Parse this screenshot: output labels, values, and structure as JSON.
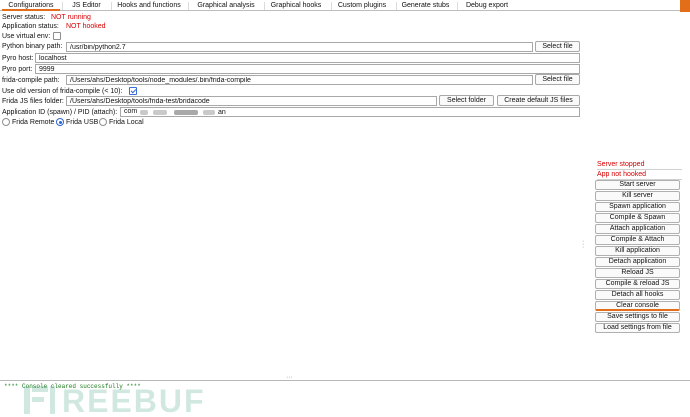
{
  "tabs": [
    {
      "label": "Configurations",
      "active": true
    },
    {
      "label": "JS Editor",
      "active": false
    },
    {
      "label": "Hooks and functions",
      "active": false
    },
    {
      "label": "Graphical analysis",
      "active": false
    },
    {
      "label": "Graphical hooks",
      "active": false
    },
    {
      "label": "Custom plugins",
      "active": false
    },
    {
      "label": "Generate stubs",
      "active": false
    },
    {
      "label": "Debug export",
      "active": false
    }
  ],
  "config": {
    "server_status_label": "Server status:",
    "server_status_value": "NOT running",
    "app_status_label": "Application status:",
    "app_status_value": "NOT hooked",
    "venv_label": "Use virtual env:",
    "venv_checked": false,
    "python_label": "Python binary path:",
    "python_value": "/usr/bin/python2.7",
    "python_button": "Select file",
    "pyro_host_label": "Pyro host:",
    "pyro_host_value": "localhost",
    "pyro_port_label": "Pyro port:",
    "pyro_port_value": "9999",
    "frida_compile_label": "frida-compile path:",
    "frida_compile_value": "/Users/ahs/Desktop/tools/node_modules/.bin/frida-compile",
    "frida_compile_button": "Select file",
    "old_version_label": "Use old version of frida-compile (< 10):",
    "old_version_checked": true,
    "js_folder_label": "Frida JS files folder:",
    "js_folder_value": "/Users/ahs/Desktop/tools/frida-test/bridacode",
    "js_folder_button": "Select folder",
    "create_js_button": "Create default JS files",
    "app_id_label": "Application ID (spawn) / PID (attach):",
    "app_id_prefix": "com",
    "app_id_suffix": "an",
    "modes": [
      {
        "label": "Frida Remote",
        "selected": false
      },
      {
        "label": "Frida USB",
        "selected": true
      },
      {
        "label": "Frida Local",
        "selected": false
      }
    ]
  },
  "panel": {
    "server_state": "Server stopped",
    "app_state": "App not hooked",
    "buttons": [
      "Start server",
      "Kill server",
      "Spawn application",
      "Compile & Spawn",
      "Attach application",
      "Compile & Attach",
      "Kill application",
      "Detach application",
      "Reload JS",
      "Compile & reload JS",
      "Detach all hooks",
      "Clear console",
      "Save settings to file",
      "Load settings from file"
    ]
  },
  "console": {
    "line": "**** Console cleared successfully ****"
  },
  "watermark": "REEBUF",
  "colors": {
    "accent": "#e36e19",
    "error": "#d40000",
    "console_text": "#1a7a1a",
    "selection": "#2d64d4"
  }
}
